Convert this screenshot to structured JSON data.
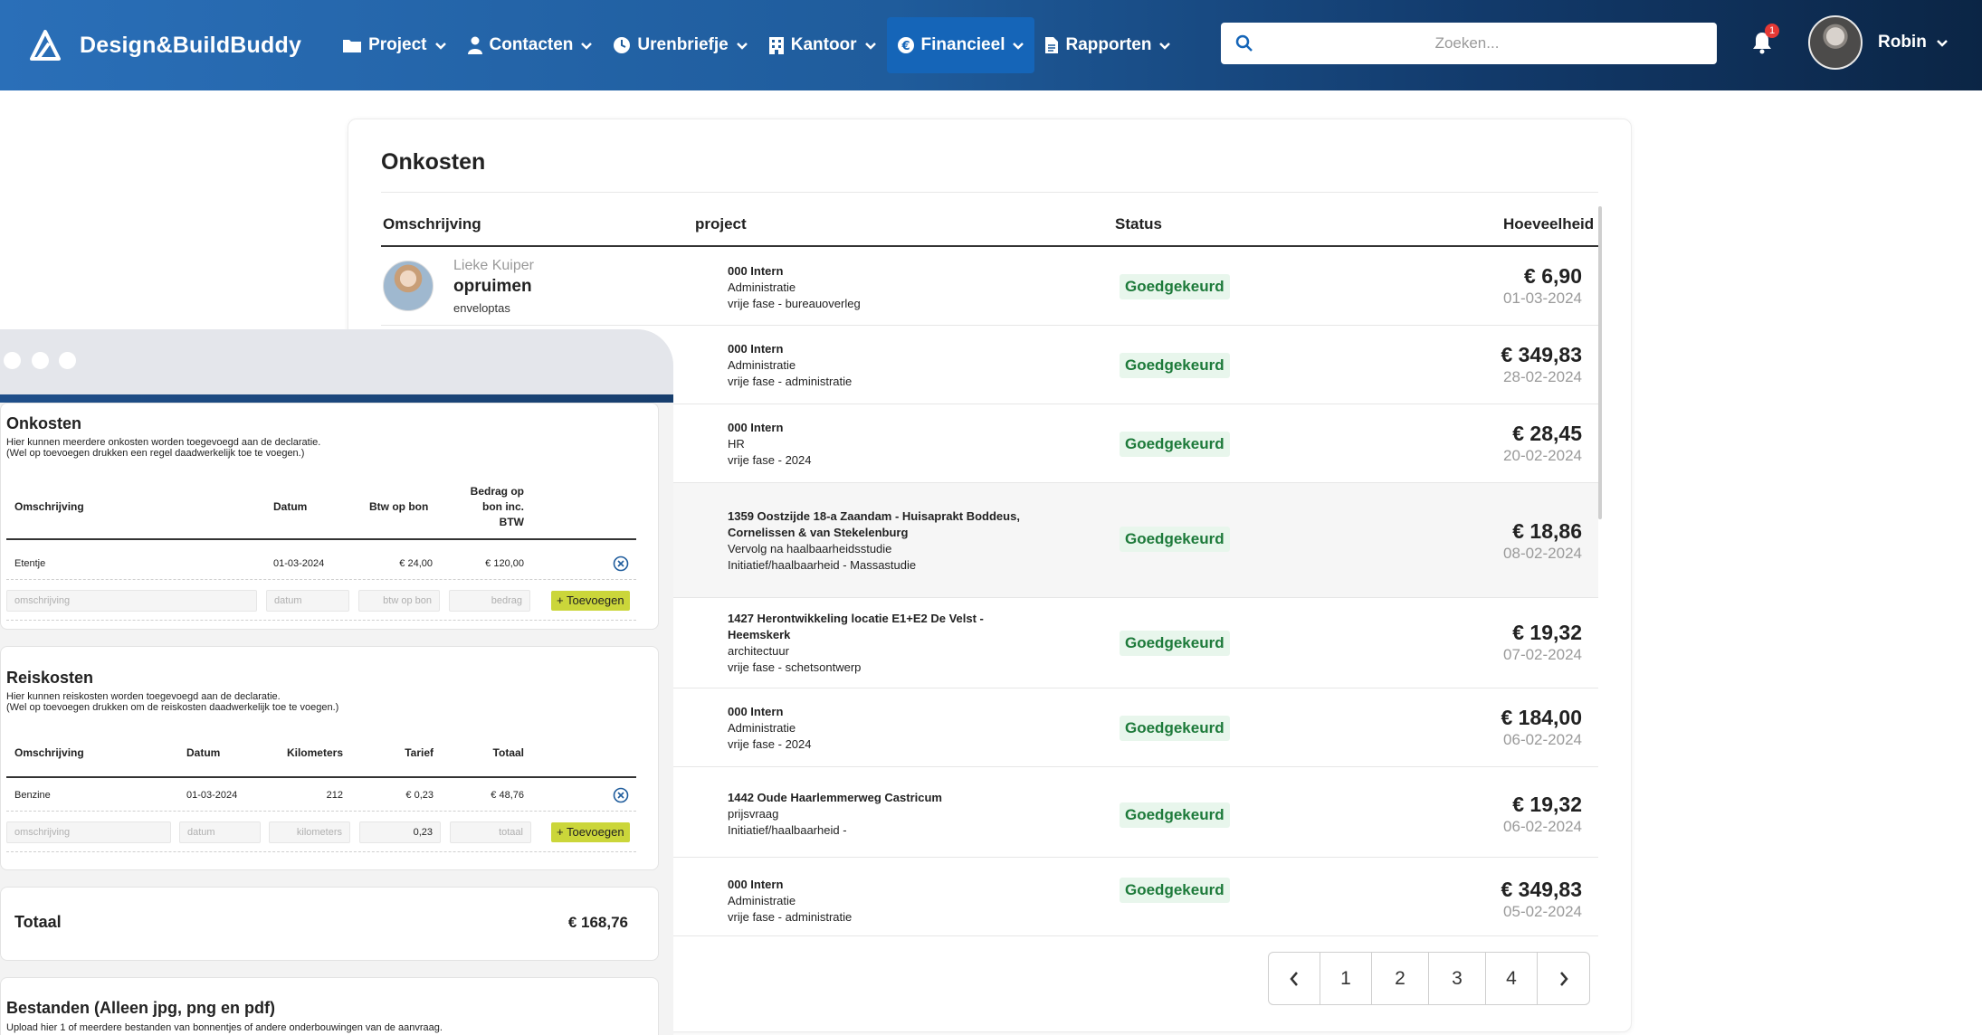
{
  "nav": {
    "brand": "Design&BuildBuddy",
    "items": [
      {
        "label": "Project",
        "icon": "folder-icon"
      },
      {
        "label": "Contacten",
        "icon": "person-icon"
      },
      {
        "label": "Urenbriefje",
        "icon": "clock-icon"
      },
      {
        "label": "Kantoor",
        "icon": "building-icon"
      },
      {
        "label": "Financieel",
        "icon": "euro-icon",
        "active": true
      },
      {
        "label": "Rapporten",
        "icon": "document-icon"
      }
    ],
    "search_placeholder": "Zoeken...",
    "notification_count": "1",
    "user_name": "Robin"
  },
  "main": {
    "title": "Onkosten",
    "columns": [
      "Omschrijving",
      "project",
      "Status",
      "Hoeveelheid"
    ],
    "first_row": {
      "person": "Lieke Kuiper",
      "description": "opruimen",
      "sub": "enveloptas"
    },
    "rows": [
      {
        "project": "000 Intern",
        "lines": [
          "Administratie",
          "vrije fase - bureauoverleg"
        ],
        "status": "Goedgekeurd",
        "amount": "€ 6,90",
        "date": "01-03-2024"
      },
      {
        "project": "000 Intern",
        "lines": [
          "Administratie",
          "vrije fase - administratie"
        ],
        "status": "Goedgekeurd",
        "amount": "€ 349,83",
        "date": "28-02-2024"
      },
      {
        "project": "000 Intern",
        "lines": [
          "HR",
          "vrije fase - 2024"
        ],
        "status": "Goedgekeurd",
        "amount": "€ 28,45",
        "date": "20-02-2024"
      },
      {
        "project": "1359 Oostzijde 18-a Zaandam - Huisaprakt Boddeus, Cornelissen & van Stekelenburg",
        "lines": [
          "Vervolg na haalbaarheidsstudie",
          "Initiatief/haalbaarheid - Massastudie"
        ],
        "status": "Goedgekeurd",
        "amount": "€ 18,86",
        "date": "08-02-2024"
      },
      {
        "project": "1427 Herontwikkeling locatie E1+E2 De Velst - Heemskerk",
        "lines": [
          "architectuur",
          "vrije fase - schetsontwerp"
        ],
        "status": "Goedgekeurd",
        "amount": "€ 19,32",
        "date": "07-02-2024"
      },
      {
        "project": "000 Intern",
        "lines": [
          "Administratie",
          "vrije fase - 2024"
        ],
        "status": "Goedgekeurd",
        "amount": "€ 184,00",
        "date": "06-02-2024"
      },
      {
        "project": "1442 Oude Haarlemmerweg Castricum",
        "lines": [
          "prijsvraag",
          "Initiatief/haalbaarheid -"
        ],
        "status": "Goedgekeurd",
        "amount": "€ 19,32",
        "date": "06-02-2024"
      },
      {
        "project": "000 Intern",
        "lines": [
          "Administratie",
          "vrije fase - administratie"
        ],
        "status": "Goedgekeurd",
        "amount": "€ 349,83",
        "date": "05-02-2024"
      }
    ],
    "pagination": {
      "pages": [
        "1",
        "2",
        "3",
        "4"
      ]
    }
  },
  "overlay": {
    "expenses": {
      "title": "Onkosten",
      "help_1": "Hier kunnen meerdere onkosten worden toegevoegd aan de declaratie.",
      "help_2": "(Wel op toevoegen drukken een regel daadwerkelijk toe te voegen.)",
      "columns": [
        "Omschrijving",
        "Datum",
        "Btw op bon",
        "Bedrag op",
        "bon inc.",
        "BTW"
      ],
      "row": {
        "description": "Etentje",
        "date": "01-03-2024",
        "vat": "€ 24,00",
        "amount": "€ 120,00"
      },
      "placeholders": {
        "description": "omschrijving",
        "date": "datum",
        "vat": "btw op bon",
        "amount": "bedrag"
      },
      "add_label": "+ Toevoegen"
    },
    "travel": {
      "title": "Reiskosten",
      "help_1": "Hier kunnen reiskosten worden toegevoegd aan de declaratie.",
      "help_2": "(Wel op toevoegen drukken om de reiskosten daadwerkelijk toe te voegen.)",
      "columns": [
        "Omschrijving",
        "Datum",
        "Kilometers",
        "Tarief",
        "Totaal"
      ],
      "row": {
        "description": "Benzine",
        "date": "01-03-2024",
        "km": "212",
        "rate": "€ 0,23",
        "total": "€ 48,76"
      },
      "placeholders": {
        "description": "omschrijving",
        "date": "datum",
        "km": "kilometers",
        "rate": "0,23",
        "total": "totaal"
      },
      "add_label": "+ Toevoegen"
    },
    "total": {
      "label": "Totaal",
      "value": "€ 168,76"
    },
    "files": {
      "title": "Bestanden (Alleen jpg, png en pdf)",
      "help": "Upload hier 1 of meerdere bestanden van bonnentjes of andere onderbouwingen van de aanvraag."
    }
  }
}
